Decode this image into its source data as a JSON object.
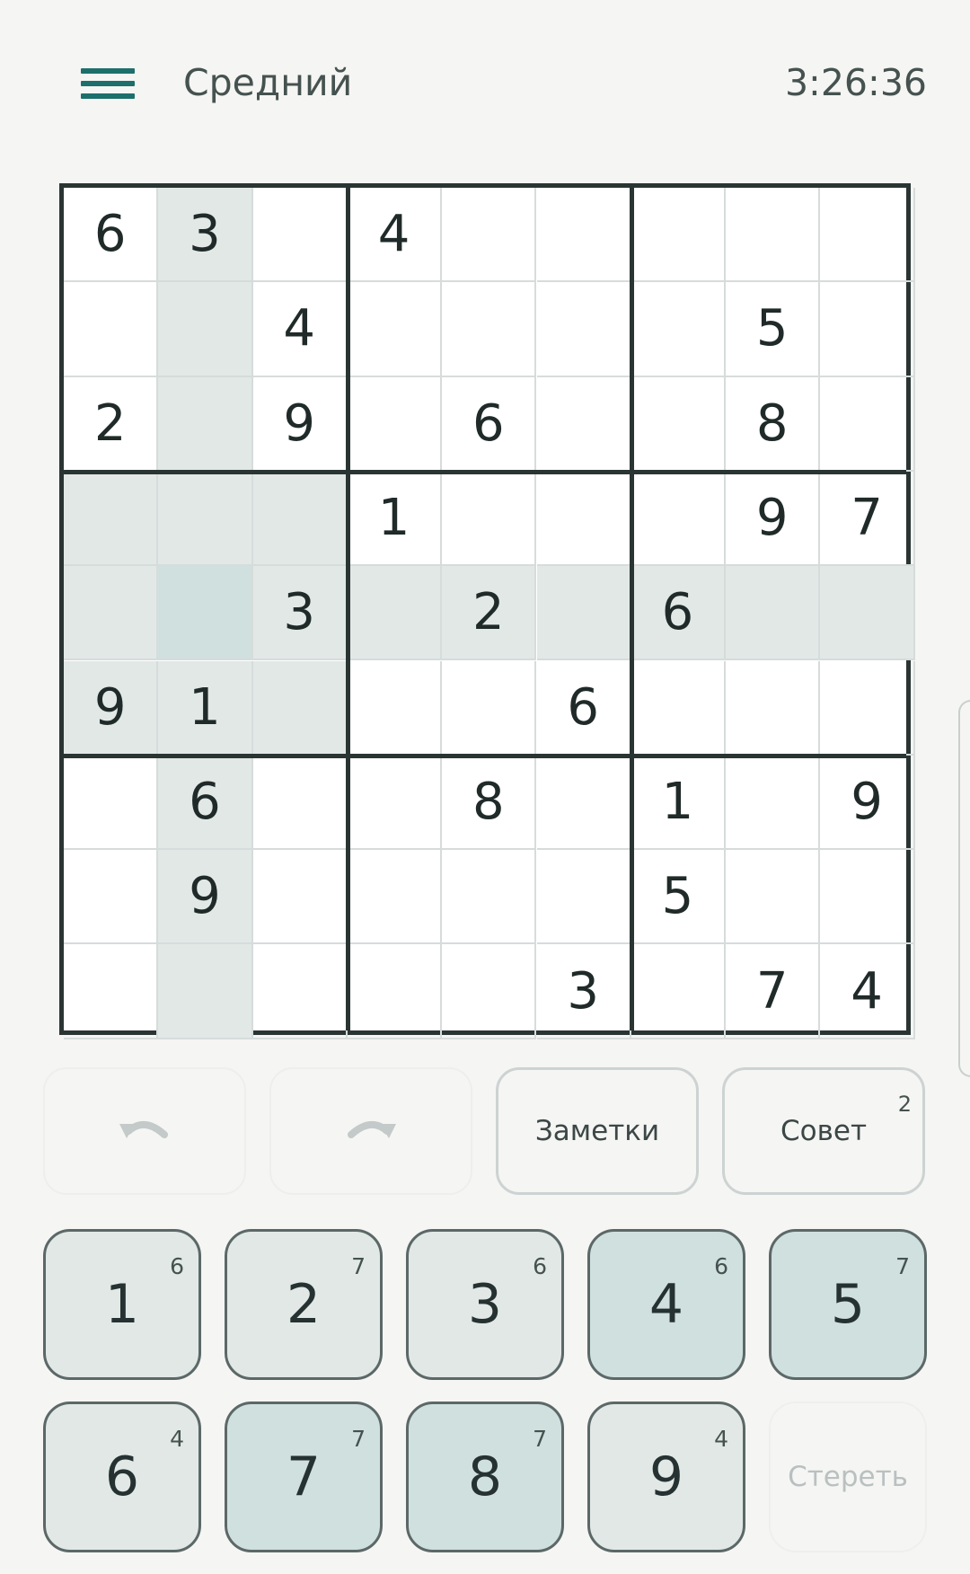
{
  "header": {
    "difficulty": "Средний",
    "timer": "3:26:36"
  },
  "board": {
    "grid": [
      [
        "6",
        "3",
        "",
        "4",
        "",
        "",
        "",
        "",
        ""
      ],
      [
        "",
        "",
        "4",
        "",
        "",
        "",
        "",
        "5",
        ""
      ],
      [
        "2",
        "",
        "9",
        "",
        "6",
        "",
        "",
        "8",
        ""
      ],
      [
        "",
        "",
        "",
        "1",
        "",
        "",
        "",
        "9",
        "7"
      ],
      [
        "",
        "",
        "3",
        "",
        "2",
        "",
        "6",
        "",
        ""
      ],
      [
        "9",
        "1",
        "",
        "",
        "",
        "6",
        "",
        "",
        ""
      ],
      [
        "",
        "6",
        "",
        "",
        "8",
        "",
        "1",
        "",
        "9"
      ],
      [
        "",
        "9",
        "",
        "",
        "",
        "",
        "5",
        "",
        ""
      ],
      [
        "",
        "",
        "",
        "",
        "",
        "3",
        "",
        "7",
        "4"
      ]
    ],
    "selected": {
      "row": 4,
      "col": 1
    }
  },
  "actions": {
    "undo_icon": "undo-icon",
    "redo_icon": "redo-icon",
    "notes_label": "Заметки",
    "hint_label": "Совет",
    "hint_count": "2"
  },
  "keypad": {
    "keys": [
      {
        "digit": "1",
        "count": "6",
        "active": false
      },
      {
        "digit": "2",
        "count": "7",
        "active": false
      },
      {
        "digit": "3",
        "count": "6",
        "active": false
      },
      {
        "digit": "4",
        "count": "6",
        "active": true
      },
      {
        "digit": "5",
        "count": "7",
        "active": true
      },
      {
        "digit": "6",
        "count": "4",
        "active": false
      },
      {
        "digit": "7",
        "count": "7",
        "active": true
      },
      {
        "digit": "8",
        "count": "7",
        "active": true
      },
      {
        "digit": "9",
        "count": "4",
        "active": false
      }
    ],
    "erase_label": "Стереть"
  },
  "colors": {
    "accent": "#1d6f6b",
    "highlight": "#e2e8e6",
    "selected": "#cfe0de"
  }
}
